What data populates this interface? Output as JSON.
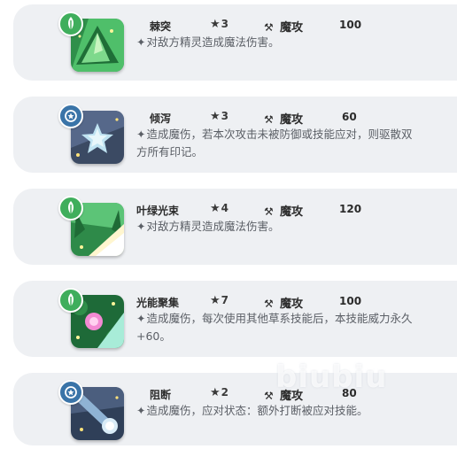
{
  "skills": [
    {
      "name": "棘突",
      "cost": "3",
      "type": "魔攻",
      "power": "100",
      "description": "对敌方精灵造成魔法伤害。",
      "element": "grass",
      "icon": "thorn-spike-skill-icon"
    },
    {
      "name": "倾泻",
      "cost": "3",
      "type": "魔攻",
      "power": "60",
      "description": "造成魔伤，若本次攻击未被防御或技能应对，则驱散双方所有印记。",
      "element": "normal",
      "icon": "pour-star-skill-icon"
    },
    {
      "name": "叶绿光束",
      "cost": "4",
      "type": "魔攻",
      "power": "120",
      "description": "对敌方精灵造成魔法伤害。",
      "element": "grass",
      "icon": "chlorophyll-beam-skill-icon"
    },
    {
      "name": "光能聚集",
      "cost": "7",
      "type": "魔攻",
      "power": "100",
      "description": "造成魔伤，每次使用其他草系技能后，本技能威力永久+60。",
      "element": "grass",
      "icon": "light-gather-skill-icon"
    },
    {
      "name": "阻断",
      "cost": "2",
      "type": "魔攻",
      "power": "80",
      "description": "造成魔伤，应对状态：额外打断被应对技能。",
      "element": "normal",
      "icon": "block-comet-skill-icon"
    }
  ],
  "watermark": "biubiu",
  "colors": {
    "card_bg": "#eef0f3",
    "grass_badge": "#3fae5c",
    "normal_badge": "#3a74a8",
    "text_dark": "#2b2b2b",
    "text_desc": "#5b5f66"
  }
}
